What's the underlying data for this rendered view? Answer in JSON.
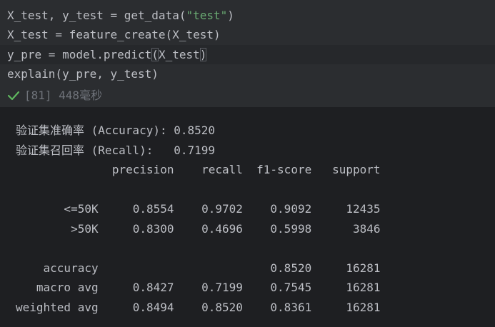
{
  "code_cell": {
    "lines": [
      {
        "before": "X_test, y_test = get_data(",
        "string": "\"test\"",
        "after": ")"
      },
      {
        "before": "X_test = feature_create(X_test)",
        "string": "",
        "after": ""
      },
      {
        "before": "y_pre = model.predict",
        "bracket": "(",
        "rest": "X_test",
        "close": ")"
      },
      {
        "before": "explain(y_pre, y_test)",
        "string": "",
        "after": ""
      }
    ],
    "status": {
      "icon": "check-icon",
      "text": "[81] 448毫秒",
      "color": "#5fb85f"
    }
  },
  "output": {
    "lines": [
      "验证集准确率 (Accuracy): 0.8520",
      "验证集召回率 (Recall):   0.7199",
      "              precision    recall  f1-score   support",
      "",
      "       <=50K     0.8554    0.9702    0.9092     12435",
      "        >50K     0.8300    0.4696    0.5998      3846",
      "",
      "    accuracy                         0.8520     16281",
      "   macro avg     0.8427    0.7199    0.7545     16281",
      "weighted avg     0.8494    0.8520    0.8361     16281"
    ]
  }
}
